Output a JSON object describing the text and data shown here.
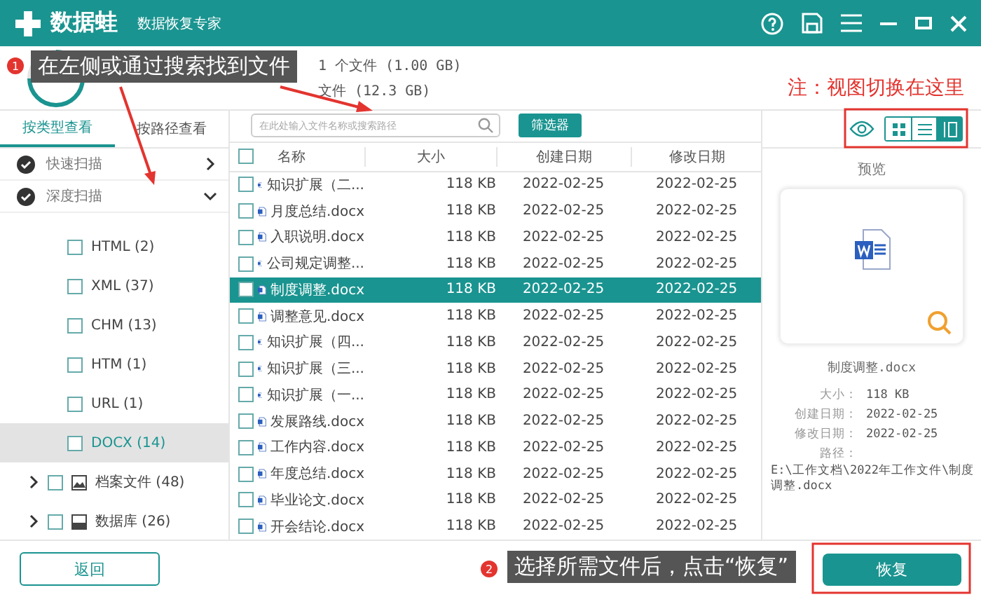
{
  "title_bar": {
    "app_name": "数据蛙",
    "subtitle": "数据恢复专家"
  },
  "scan_status": [
    "1 个文件 (1.00 GB)",
    "文件 (12.3 GB)"
  ],
  "callouts": [
    {
      "number": "1",
      "text": "在左侧或通过搜索找到文件"
    },
    {
      "number": "2",
      "text": "选择所需文件后，点击“恢复”"
    }
  ],
  "note": "注：视图切换在这里",
  "side_tabs": [
    {
      "label": "按类型查看",
      "selected": true
    },
    {
      "label": "按路径查看",
      "selected": false
    }
  ],
  "scans": [
    {
      "label": "快速扫描",
      "expanded": false
    },
    {
      "label": "深度扫描",
      "expanded": true,
      "children": [
        {
          "kind": "type",
          "label": "HTML (2)",
          "selected": false
        },
        {
          "kind": "type",
          "label": "XML (37)",
          "selected": false
        },
        {
          "kind": "type",
          "label": "CHM (13)",
          "selected": false
        },
        {
          "kind": "type",
          "label": "HTM (1)",
          "selected": false
        },
        {
          "kind": "type",
          "label": "URL (1)",
          "selected": false
        },
        {
          "kind": "type",
          "label": "DOCX (14)",
          "selected": true
        },
        {
          "kind": "archive",
          "label": "档案文件 (48)",
          "selected": false
        },
        {
          "kind": "database",
          "label": "数据库 (26)",
          "selected": false
        }
      ]
    }
  ],
  "search": {
    "placeholder": "在此处输入文件名称或搜索路径"
  },
  "filter_button": "筛选器",
  "views": [
    {
      "kind": "grid",
      "selected": false
    },
    {
      "kind": "list",
      "selected": false
    },
    {
      "kind": "preview",
      "selected": true
    }
  ],
  "table": {
    "all_checked": false,
    "columns": [
      "名称",
      "大小",
      "创建日期",
      "修改日期"
    ],
    "rows": [
      {
        "name": "知识扩展（二...",
        "size": "118 KB",
        "created": "2022-02-25",
        "modified": "2022-02-25",
        "selected": false
      },
      {
        "name": "月度总结.docx",
        "size": "118 KB",
        "created": "2022-02-25",
        "modified": "2022-02-25",
        "selected": false
      },
      {
        "name": "入职说明.docx",
        "size": "118 KB",
        "created": "2022-02-25",
        "modified": "2022-02-25",
        "selected": false
      },
      {
        "name": "公司规定调整...",
        "size": "118 KB",
        "created": "2022-02-25",
        "modified": "2022-02-25",
        "selected": false
      },
      {
        "name": "制度调整.docx",
        "size": "118 KB",
        "created": "2022-02-25",
        "modified": "2022-02-25",
        "selected": true
      },
      {
        "name": "调整意见.docx",
        "size": "118 KB",
        "created": "2022-02-25",
        "modified": "2022-02-25",
        "selected": false
      },
      {
        "name": "知识扩展（四...",
        "size": "118 KB",
        "created": "2022-02-25",
        "modified": "2022-02-25",
        "selected": false
      },
      {
        "name": "知识扩展（三...",
        "size": "118 KB",
        "created": "2022-02-25",
        "modified": "2022-02-25",
        "selected": false
      },
      {
        "name": "知识扩展（一...",
        "size": "118 KB",
        "created": "2022-02-25",
        "modified": "2022-02-25",
        "selected": false
      },
      {
        "name": "发展路线.docx",
        "size": "118 KB",
        "created": "2022-02-25",
        "modified": "2022-02-25",
        "selected": false
      },
      {
        "name": "工作内容.docx",
        "size": "118 KB",
        "created": "2022-02-25",
        "modified": "2022-02-25",
        "selected": false
      },
      {
        "name": "年度总结.docx",
        "size": "118 KB",
        "created": "2022-02-25",
        "modified": "2022-02-25",
        "selected": false
      },
      {
        "name": "毕业论文.docx",
        "size": "118 KB",
        "created": "2022-02-25",
        "modified": "2022-02-25",
        "selected": false
      },
      {
        "name": "开会结论.docx",
        "size": "118 KB",
        "created": "2022-02-25",
        "modified": "2022-02-25",
        "selected": false
      }
    ]
  },
  "preview": {
    "title": "预览",
    "file_name": "制度调整.docx",
    "fields": [
      {
        "label": "大小：",
        "value": "118 KB"
      },
      {
        "label": "创建日期：",
        "value": "2022-02-25"
      },
      {
        "label": "修改日期：",
        "value": "2022-02-25"
      }
    ],
    "path_label": "路径：",
    "path": "E:\\工作文档\\2022年工作文件\\制度调整.docx"
  },
  "buttons": {
    "back": "返回",
    "recover": "恢复"
  }
}
